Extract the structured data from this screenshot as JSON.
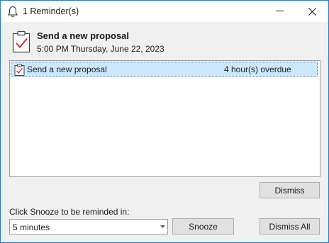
{
  "window": {
    "title": "1 Reminder(s)",
    "title_icon": "bell-icon",
    "controls": [
      "minimize-icon",
      "close-icon"
    ]
  },
  "reminder_header": {
    "icon": "task-clipboard-icon",
    "subject": "Send a new proposal",
    "due_time": "5:00 PM Thursday, June 22, 2023"
  },
  "reminder_list": {
    "items": [
      {
        "icon": "task-clipboard-icon",
        "subject": "Send a new proposal",
        "due_in": "4 hour(s) overdue",
        "selected": true
      }
    ]
  },
  "actions": {
    "dismiss_label": "Dismiss",
    "snooze_prompt": "Click Snooze to be reminded in:",
    "snooze_selected": "5 minutes",
    "snooze_label": "Snooze",
    "dismiss_all_label": "Dismiss All"
  },
  "colors": {
    "window_border": "#2b79c8",
    "selection_background": "#cce8ff",
    "task_check": "#c8202f"
  }
}
